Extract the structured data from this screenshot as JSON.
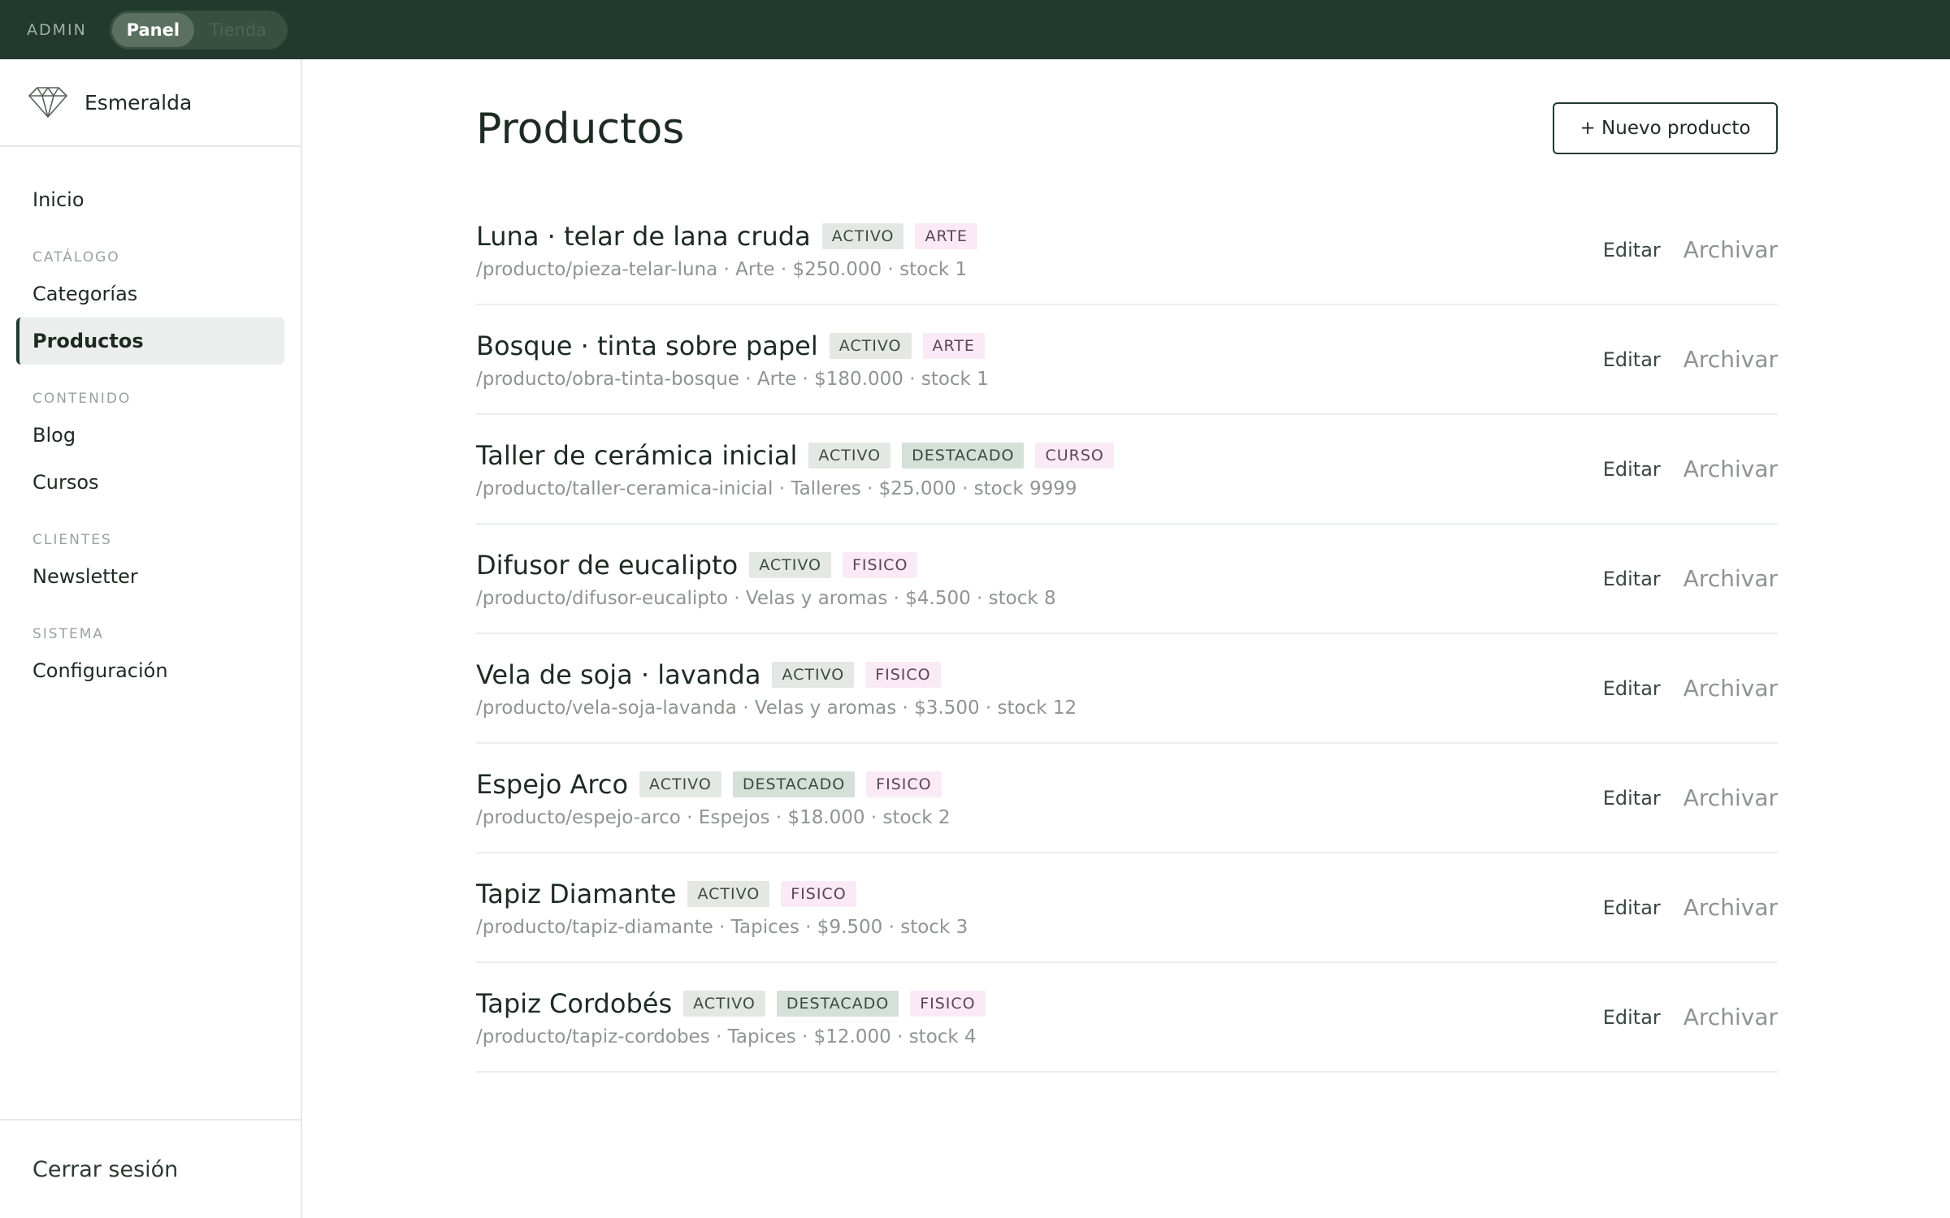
{
  "topbar": {
    "admin_label": "ADMIN",
    "mode_active": "Panel",
    "mode_inactive": "Tienda"
  },
  "sidebar": {
    "brand_name": "Esmeralda",
    "home": "Inicio",
    "section_catalog": "CATÁLOGO",
    "item_categories": "Categorías",
    "item_products": "Productos",
    "section_content": "CONTENIDO",
    "item_blog": "Blog",
    "item_courses": "Cursos",
    "section_clients": "CLIENTES",
    "item_newsletter": "Newsletter",
    "section_system": "SISTEMA",
    "item_settings": "Configuración",
    "logout": "Cerrar sesión"
  },
  "main": {
    "title": "Productos",
    "new_button": "+ Nuevo producto",
    "edit_label": "Editar",
    "archive_label": "Archivar",
    "products": [
      {
        "name": "Luna · telar de lana cruda",
        "badges": [
          "ACTIVO",
          "ARTE"
        ],
        "meta": "/producto/pieza-telar-luna · Arte · $250.000 · stock 1"
      },
      {
        "name": "Bosque · tinta sobre papel",
        "badges": [
          "ACTIVO",
          "ARTE"
        ],
        "meta": "/producto/obra-tinta-bosque · Arte · $180.000 · stock 1"
      },
      {
        "name": "Taller de cerámica inicial",
        "badges": [
          "ACTIVO",
          "DESTACADO",
          "CURSO"
        ],
        "meta": "/producto/taller-ceramica-inicial · Talleres · $25.000 · stock 9999"
      },
      {
        "name": "Difusor de eucalipto",
        "badges": [
          "ACTIVO",
          "FISICO"
        ],
        "meta": "/producto/difusor-eucalipto · Velas y aromas · $4.500 · stock 8"
      },
      {
        "name": "Vela de soja · lavanda",
        "badges": [
          "ACTIVO",
          "FISICO"
        ],
        "meta": "/producto/vela-soja-lavanda · Velas y aromas · $3.500 · stock 12"
      },
      {
        "name": "Espejo Arco",
        "badges": [
          "ACTIVO",
          "DESTACADO",
          "FISICO"
        ],
        "meta": "/producto/espejo-arco · Espejos · $18.000 · stock 2"
      },
      {
        "name": "Tapiz Diamante",
        "badges": [
          "ACTIVO",
          "FISICO"
        ],
        "meta": "/producto/tapiz-diamante · Tapices · $9.500 · stock 3"
      },
      {
        "name": "Tapiz Cordobés",
        "badges": [
          "ACTIVO",
          "DESTACADO",
          "FISICO"
        ],
        "meta": "/producto/tapiz-cordobes · Tapices · $12.000 · stock 4"
      }
    ]
  },
  "icons": {
    "brand_logo": "diamond-logo-icon"
  },
  "colors": {
    "topbar_bg": "#213a2d",
    "badge_activo_bg": "#e4e8e5",
    "badge_destacado_bg": "#d5e0d8",
    "badge_tipo_bg": "#faeaf6"
  }
}
